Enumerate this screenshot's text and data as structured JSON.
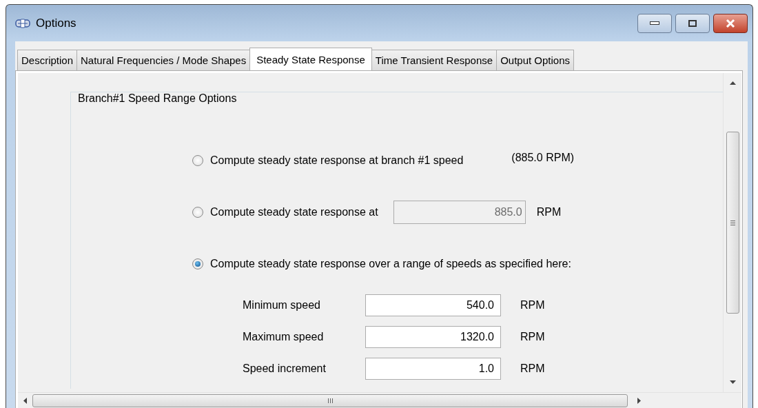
{
  "window": {
    "title": "Options"
  },
  "tabs": [
    {
      "label": "Description",
      "selected": false
    },
    {
      "label": "Natural Frequencies / Mode Shapes",
      "selected": false
    },
    {
      "label": "Steady State Response",
      "selected": true
    },
    {
      "label": "Time Transient Response",
      "selected": false
    },
    {
      "label": "Output Options",
      "selected": false
    }
  ],
  "group": {
    "title": "Branch#1 Speed Range Options",
    "options": [
      {
        "kind": "note",
        "label": "Compute steady state response at branch #1 speed",
        "selected": false,
        "note": "(885.0 RPM)"
      },
      {
        "kind": "field",
        "label": "Compute steady state response at",
        "selected": false,
        "value": "885.0",
        "disabled": true,
        "unit": "RPM"
      },
      {
        "kind": "range",
        "label": "Compute steady state response over a range of speeds as specified here:",
        "selected": true,
        "fields": [
          {
            "label": "Minimum speed",
            "value": "540.0",
            "unit": "RPM"
          },
          {
            "label": "Maximum speed",
            "value": "1320.0",
            "unit": "RPM"
          },
          {
            "label": "Speed increment",
            "value": "1.0",
            "unit": "RPM"
          }
        ]
      }
    ]
  }
}
